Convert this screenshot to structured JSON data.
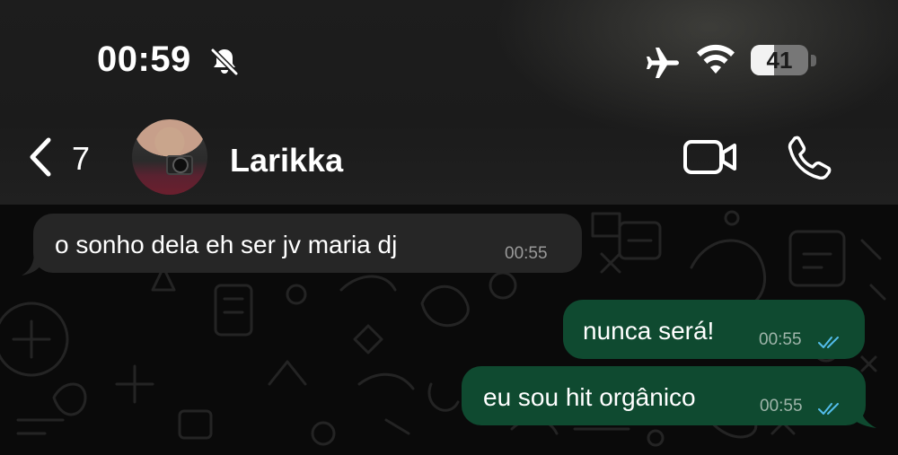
{
  "status_bar": {
    "time": "00:59",
    "battery_percent": "41",
    "battery_level": 0.41,
    "icons": [
      "bell-slash-icon",
      "airplane-icon",
      "wifi-icon",
      "battery-icon"
    ]
  },
  "header": {
    "back_count": "7",
    "contact_name": "Larikka",
    "icons": [
      "chevron-left-icon",
      "video-camera-icon",
      "phone-icon"
    ]
  },
  "messages": [
    {
      "direction": "incoming",
      "text": "o sonho dela eh ser jv maria dj",
      "time": "00:55"
    },
    {
      "direction": "outgoing",
      "text": "nunca será!",
      "time": "00:55",
      "status": "read"
    },
    {
      "direction": "outgoing",
      "text": "eu sou hit orgânico",
      "time": "00:55",
      "status": "read"
    }
  ],
  "colors": {
    "incoming_bubble": "#262626",
    "outgoing_bubble": "#0f4a30",
    "read_ticks": "#53bdeb"
  }
}
